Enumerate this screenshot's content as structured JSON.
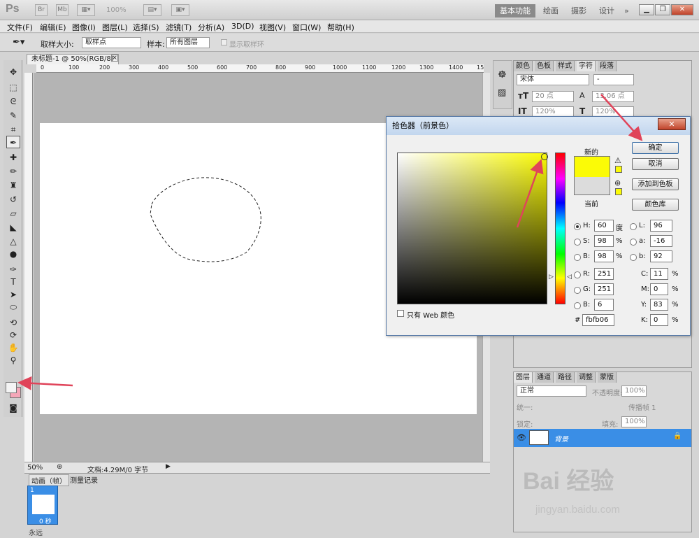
{
  "titlebar": {
    "app_logo": "Ps",
    "br_label": "Br",
    "mb_label": "Mb",
    "zoom": "100%",
    "workspaces": [
      "基本功能",
      "绘画",
      "摄影",
      "设计"
    ],
    "more": "»"
  },
  "menu": [
    "文件(F)",
    "编辑(E)",
    "图像(I)",
    "图层(L)",
    "选择(S)",
    "滤镜(T)",
    "分析(A)",
    "3D(D)",
    "视图(V)",
    "窗口(W)",
    "帮助(H)"
  ],
  "options": {
    "sample_size_label": "取样大小:",
    "sample_size_value": "取样点",
    "sample_label": "样本:",
    "sample_value": "所有图层",
    "show_ring": "显示取样环"
  },
  "document": {
    "tab": "未标题-1 @ 50%(RGB/8)",
    "ruler_ticks": [
      "0",
      "100",
      "200",
      "300",
      "400",
      "500",
      "600",
      "700",
      "800",
      "900",
      "1000",
      "1100",
      "1200",
      "1300",
      "1400",
      "15"
    ],
    "zoom": "50%",
    "doc_info": "文档:4.29M/0 字节"
  },
  "char_panel": {
    "tabs": [
      "颜色",
      "色板",
      "样式",
      "字符",
      "段落"
    ],
    "font": "宋体",
    "font_style": "-",
    "size": "20 点",
    "leading": "13.06 点",
    "vscale": "120%",
    "hscale": "120%"
  },
  "layers_panel": {
    "tabs": [
      "图层",
      "通道",
      "路径",
      "调整",
      "蒙版"
    ],
    "blend": "正常",
    "opacity_label": "不透明度:",
    "opacity": "100%",
    "unify_label": "统一:",
    "propagate": "传播帧 1",
    "lock_label": "锁定:",
    "fill_label": "填充:",
    "fill": "100%",
    "layer_name": "背景"
  },
  "animation": {
    "tabs": [
      "动画（帧）",
      "测量记录"
    ],
    "frame_number": "1",
    "frame_time": "0 秒",
    "loop": "永远"
  },
  "picker": {
    "title": "拾色器（前景色）",
    "new_label": "新的",
    "current_label": "当前",
    "ok": "确定",
    "cancel": "取消",
    "add_swatch": "添加到色板",
    "color_lib": "颜色库",
    "web_only": "只有 Web 颜色",
    "fields": {
      "H": "60",
      "H_unit": "度",
      "S": "98",
      "S_unit": "%",
      "B": "98",
      "B_unit": "%",
      "R": "251",
      "G": "251",
      "Bb": "6",
      "L": "96",
      "a": "-16",
      "b": "92",
      "C": "11",
      "M": "0",
      "Y": "83",
      "K": "0",
      "hex": "fbfb06"
    },
    "new_color": "#fbfb06",
    "current_color": "#dcdcdc"
  },
  "watermark": {
    "brand": "Bai 经验",
    "url": "jingyan.baidu.com"
  },
  "colors": {
    "accent_arrow": "#e0445a",
    "layer_selected": "#3a8ee6",
    "foreground_swatch": "#f4f4f4",
    "background_swatch": "#f5a7b8"
  }
}
